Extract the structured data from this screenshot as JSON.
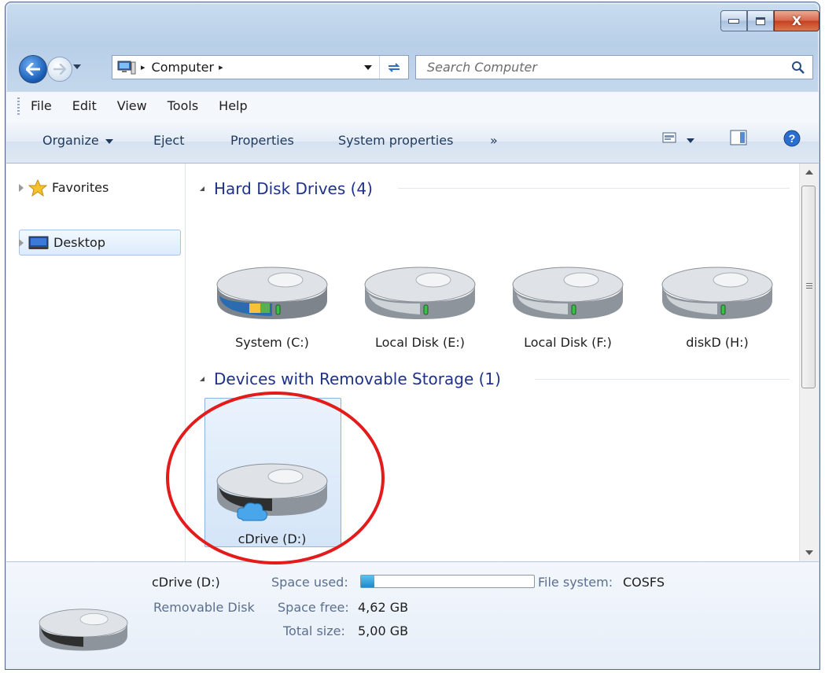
{
  "window": {
    "caption_buttons": [
      "minimize",
      "maximize",
      "close"
    ],
    "close_glyph": "X"
  },
  "address_bar": {
    "crumbs": [
      "Computer"
    ],
    "separator": "▸"
  },
  "search": {
    "placeholder": "Search Computer"
  },
  "menu": {
    "items": [
      "File",
      "Edit",
      "View",
      "Tools",
      "Help"
    ]
  },
  "command_bar": {
    "organize": "Organize",
    "eject": "Eject",
    "properties": "Properties",
    "system_properties": "System properties",
    "more": "»"
  },
  "nav_pane": {
    "items": [
      {
        "label": "Favorites",
        "icon": "star-icon"
      },
      {
        "label": "Desktop",
        "icon": "desktop-icon",
        "selected": true
      }
    ]
  },
  "content": {
    "groups": [
      {
        "header": "Hard Disk Drives (4)",
        "drives": [
          {
            "label": "System (C:)",
            "icon": "system-drive-icon"
          },
          {
            "label": "Local Disk (E:)",
            "icon": "hard-drive-icon"
          },
          {
            "label": "Local Disk (F:)",
            "icon": "hard-drive-icon"
          },
          {
            "label": "diskD (H:)",
            "icon": "hard-drive-icon"
          }
        ]
      },
      {
        "header": "Devices with Removable Storage (1)",
        "drives": [
          {
            "label": "cDrive (D:)",
            "icon": "cloud-drive-icon",
            "selected": true
          }
        ]
      }
    ]
  },
  "details": {
    "name": "cDrive (D:)",
    "type": "Removable Disk",
    "space_used_label": "Space used:",
    "space_used_fraction": 0.076,
    "space_free_label": "Space free:",
    "space_free_value": "4,62 GB",
    "total_size_label": "Total size:",
    "total_size_value": "5,00 GB",
    "file_system_label": "File system:",
    "file_system_value": "COSFS"
  },
  "colors": {
    "group_header": "#1e3287",
    "annotation_ring": "#e31b1b",
    "selection_bg": "#d4e5f8"
  }
}
